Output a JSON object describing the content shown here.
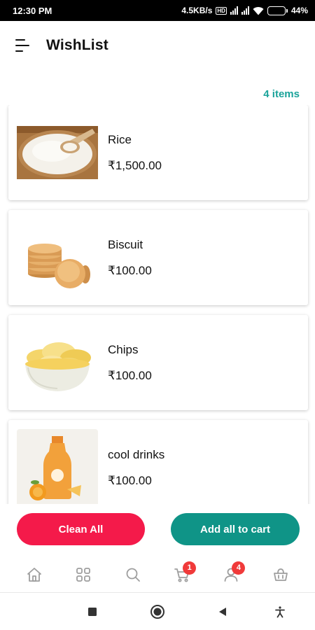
{
  "status_bar": {
    "time": "12:30 PM",
    "network_speed": "4.5KB/s",
    "battery_percent": "44%",
    "battery_level": 0.44,
    "battery_color": "#f7b500"
  },
  "header": {
    "menu_icon": "menu-icon",
    "title": "WishList"
  },
  "items_count": "4 items",
  "wishlist": [
    {
      "name": "Rice",
      "price": "₹1,500.00",
      "image": "rice-bowl"
    },
    {
      "name": "Biscuit",
      "price": "₹100.00",
      "image": "biscuits"
    },
    {
      "name": "Chips",
      "price": "₹100.00",
      "image": "chips-bowl"
    },
    {
      "name": "cool drinks",
      "price": "₹100.00",
      "image": "juice-bottle"
    }
  ],
  "buttons": {
    "clean_all": "Clean All",
    "add_all": "Add all to cart"
  },
  "bottom_nav": [
    {
      "icon": "home-icon"
    },
    {
      "icon": "grid-icon"
    },
    {
      "icon": "search-icon"
    },
    {
      "icon": "cart-icon",
      "badge": "1"
    },
    {
      "icon": "user-icon",
      "badge": "4"
    },
    {
      "icon": "basket-icon"
    }
  ],
  "colors": {
    "accent_teal": "#0f9487",
    "accent_red": "#f41a4a",
    "items_count": "#1aa39a",
    "badge": "#f03a3a",
    "nav_icon": "#9e9e9e"
  }
}
